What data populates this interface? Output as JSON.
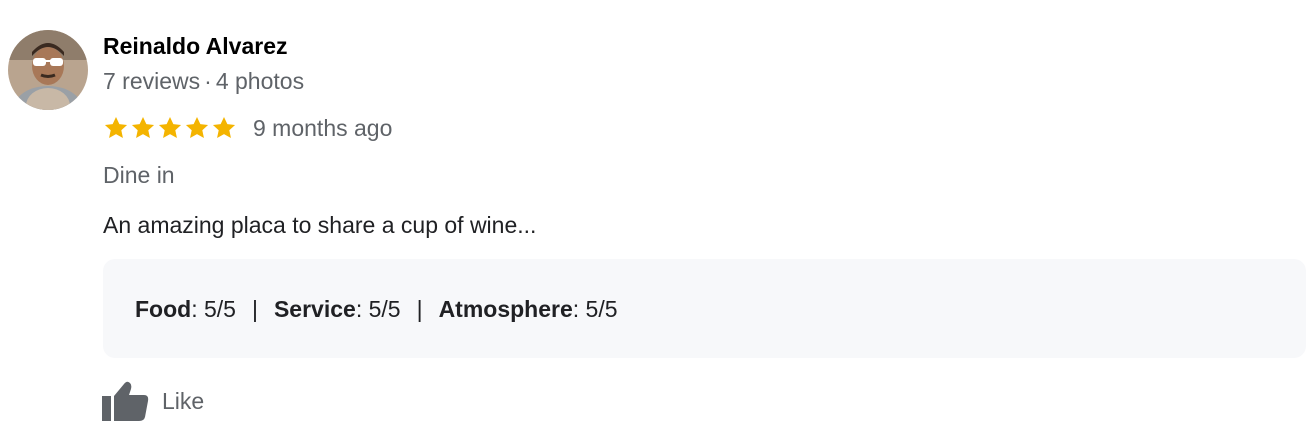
{
  "review": {
    "author": "Reinaldo Alvarez",
    "reviews_count": "7 reviews",
    "meta_separator": "·",
    "photos_count": "4 photos",
    "rating": 5,
    "rating_max": 5,
    "time_ago": "9 months ago",
    "service_type": "Dine in",
    "text": "An amazing placa to share a cup of wine...",
    "attributes": [
      {
        "label": "Food",
        "value": ": 5/5"
      },
      {
        "label": "Service",
        "value": ": 5/5"
      },
      {
        "label": "Atmosphere",
        "value": ": 5/5"
      }
    ],
    "attribute_separator": "|",
    "like_label": "Like"
  },
  "icons": {
    "avatar": "user-avatar-photo",
    "star": "star-icon",
    "like": "thumbs-up-icon"
  },
  "colors": {
    "star": "#f4b400",
    "attributes_background": "#f7f8fa",
    "secondary_text": "#5f6368",
    "like_icon": "#5f6368"
  }
}
